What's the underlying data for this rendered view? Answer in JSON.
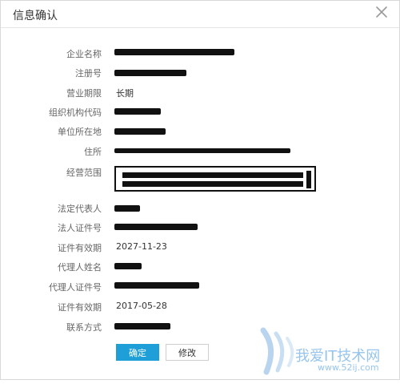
{
  "dialog": {
    "title": "信息确认",
    "close_icon": "close-icon"
  },
  "fields": [
    {
      "label": "企业名称",
      "value": "",
      "redacted": true
    },
    {
      "label": "注册号",
      "value": "",
      "redacted": true
    },
    {
      "label": "营业期限",
      "value": "长期",
      "redacted": false
    },
    {
      "label": "组织机构代码",
      "value": "",
      "redacted": true
    },
    {
      "label": "单位所在地",
      "value": "",
      "redacted": true
    },
    {
      "label": "住所",
      "value": "",
      "redacted": true
    },
    {
      "label": "经营范围",
      "value": "",
      "redacted": true
    },
    {
      "label": "法定代表人",
      "value": "",
      "redacted": true
    },
    {
      "label": "法人证件号",
      "value": "",
      "redacted": true
    },
    {
      "label": "证件有效期",
      "value": "2027-11-23",
      "redacted": false
    },
    {
      "label": "代理人姓名",
      "value": "",
      "redacted": true
    },
    {
      "label": "代理人证件号",
      "value": "",
      "redacted": true
    },
    {
      "label": "证件有效期",
      "value": "2017-05-28",
      "redacted": false
    },
    {
      "label": "联系方式",
      "value": "",
      "redacted": true
    }
  ],
  "buttons": {
    "confirm": "确定",
    "edit": "修改"
  },
  "watermark": {
    "text": "我爱IT技术网",
    "url": "www.52ij.com"
  },
  "colors": {
    "primary": "#1e9fd8",
    "label": "#666666",
    "value": "#333333",
    "border": "#d9d9d9"
  }
}
